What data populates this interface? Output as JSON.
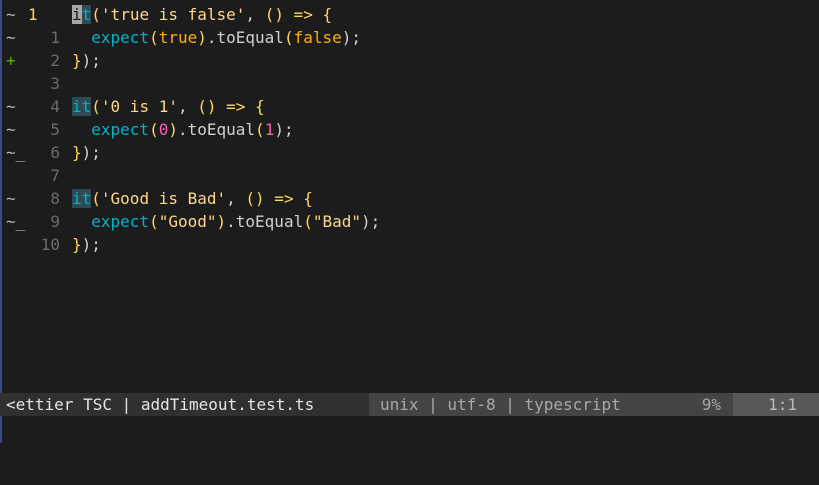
{
  "editor": {
    "lines": [
      {
        "sign": "~",
        "sign_kind": "change",
        "lnr": "1",
        "current": true,
        "tokens": [
          {
            "t": "i",
            "c": "cursor-cell"
          },
          {
            "t": "t",
            "c": "hl-it"
          },
          {
            "t": "(",
            "c": "tok-paren"
          },
          {
            "t": "'true is false'",
            "c": "tok-str"
          },
          {
            "t": ", ",
            "c": "tok-punct"
          },
          {
            "t": "()",
            "c": "tok-paren"
          },
          {
            "t": " => ",
            "c": "tok-arrow"
          },
          {
            "t": "{",
            "c": "tok-brace"
          }
        ]
      },
      {
        "sign": "~",
        "sign_kind": "change",
        "lnr": "1",
        "current": false,
        "tokens": [
          {
            "t": "  expect",
            "c": "tok-fn"
          },
          {
            "t": "(",
            "c": "tok-paren"
          },
          {
            "t": "true",
            "c": "tok-bool"
          },
          {
            "t": ")",
            "c": "tok-paren"
          },
          {
            "t": ".toEqual",
            "c": "tok-punct"
          },
          {
            "t": "(",
            "c": "tok-paren"
          },
          {
            "t": "false",
            "c": "tok-bool"
          },
          {
            "t": ");",
            "c": "tok-punct"
          }
        ]
      },
      {
        "sign": "+",
        "sign_kind": "add",
        "lnr": "2",
        "current": false,
        "tokens": [
          {
            "t": "}",
            "c": "tok-brace"
          },
          {
            "t": ");",
            "c": "tok-punct"
          }
        ]
      },
      {
        "sign": "",
        "sign_kind": "none",
        "lnr": "3",
        "current": false,
        "tokens": []
      },
      {
        "sign": "~",
        "sign_kind": "change",
        "lnr": "4",
        "current": false,
        "tokens": [
          {
            "t": "it",
            "c": "hl-it"
          },
          {
            "t": "(",
            "c": "tok-paren"
          },
          {
            "t": "'0 is 1'",
            "c": "tok-str"
          },
          {
            "t": ", ",
            "c": "tok-punct"
          },
          {
            "t": "()",
            "c": "tok-paren"
          },
          {
            "t": " => ",
            "c": "tok-arrow"
          },
          {
            "t": "{",
            "c": "tok-brace"
          }
        ]
      },
      {
        "sign": "~",
        "sign_kind": "change",
        "lnr": "5",
        "current": false,
        "tokens": [
          {
            "t": "  expect",
            "c": "tok-fn"
          },
          {
            "t": "(",
            "c": "tok-paren"
          },
          {
            "t": "0",
            "c": "tok-num"
          },
          {
            "t": ")",
            "c": "tok-paren"
          },
          {
            "t": ".toEqual",
            "c": "tok-punct"
          },
          {
            "t": "(",
            "c": "tok-paren"
          },
          {
            "t": "1",
            "c": "tok-num"
          },
          {
            "t": ");",
            "c": "tok-punct"
          }
        ]
      },
      {
        "sign": "~_",
        "sign_kind": "change",
        "lnr": "6",
        "current": false,
        "tokens": [
          {
            "t": "}",
            "c": "tok-brace"
          },
          {
            "t": ");",
            "c": "tok-punct"
          }
        ]
      },
      {
        "sign": "",
        "sign_kind": "none",
        "lnr": "7",
        "current": false,
        "tokens": []
      },
      {
        "sign": "~",
        "sign_kind": "change",
        "lnr": "8",
        "current": false,
        "tokens": [
          {
            "t": "it",
            "c": "hl-it"
          },
          {
            "t": "(",
            "c": "tok-paren"
          },
          {
            "t": "'Good is Bad'",
            "c": "tok-str"
          },
          {
            "t": ", ",
            "c": "tok-punct"
          },
          {
            "t": "()",
            "c": "tok-paren"
          },
          {
            "t": " => ",
            "c": "tok-arrow"
          },
          {
            "t": "{",
            "c": "tok-brace"
          }
        ]
      },
      {
        "sign": "~_",
        "sign_kind": "change",
        "lnr": "9",
        "current": false,
        "tokens": [
          {
            "t": "  expect",
            "c": "tok-fn"
          },
          {
            "t": "(",
            "c": "tok-paren"
          },
          {
            "t": "\"Good\"",
            "c": "tok-str"
          },
          {
            "t": ")",
            "c": "tok-paren"
          },
          {
            "t": ".toEqual",
            "c": "tok-punct"
          },
          {
            "t": "(",
            "c": "tok-paren"
          },
          {
            "t": "\"Bad\"",
            "c": "tok-str"
          },
          {
            "t": ");",
            "c": "tok-punct"
          }
        ]
      },
      {
        "sign": "",
        "sign_kind": "none",
        "lnr": "10",
        "current": false,
        "tokens": [
          {
            "t": "}",
            "c": "tok-brace"
          },
          {
            "t": ");",
            "c": "tok-punct"
          }
        ]
      }
    ]
  },
  "statusline": {
    "left": "<ettier TSC | addTimeout.test.ts",
    "middle": "unix | utf-8 | typescript",
    "percent": "9%",
    "position": "1:1"
  },
  "colors": {
    "background": "#1c1c1c",
    "string": "#ffd787",
    "keyword": "#00b4c8",
    "number": "#ff5faf",
    "boolean": "#ffaf00",
    "line_number_current": "#ffd75f",
    "git_add": "#5faf00"
  }
}
